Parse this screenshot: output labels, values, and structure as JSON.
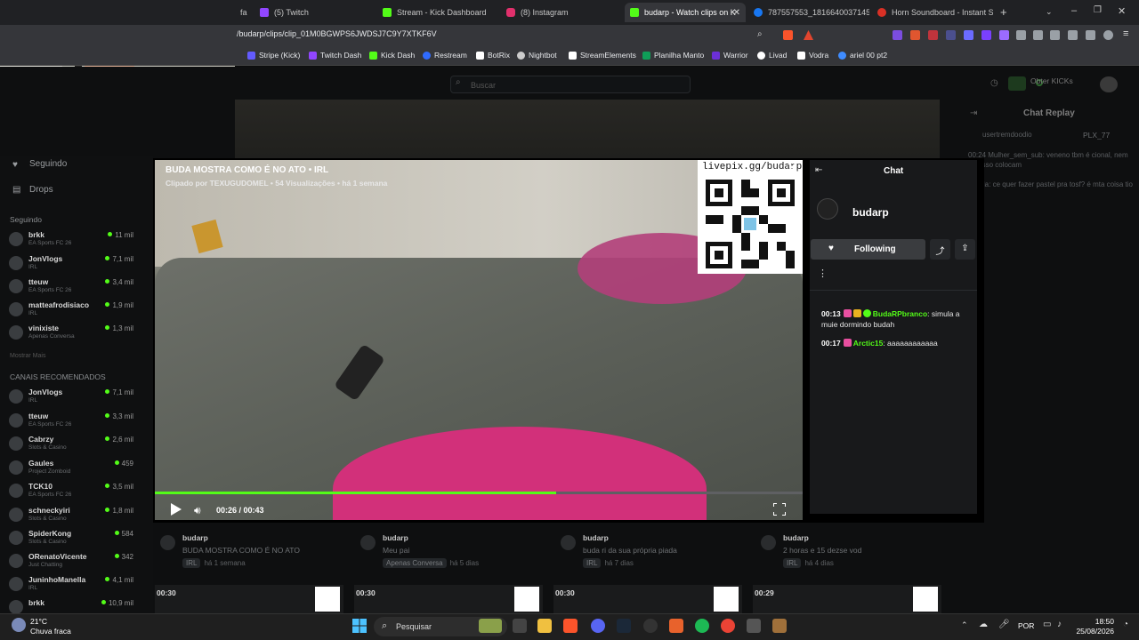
{
  "browser": {
    "tabs": [
      {
        "label": "fa",
        "color": "#9146ff"
      },
      {
        "label": "(5) Twitch",
        "color": "#9146ff"
      },
      {
        "label": "Stream - Kick Dashboard",
        "color": "#53fc18"
      },
      {
        "label": "(8) Instagram",
        "color": "#e1306c"
      },
      {
        "label": "budarp - Watch clips on K",
        "color": "#53fc18"
      },
      {
        "label": "787557553_181664003714507",
        "color": "#1877f2"
      },
      {
        "label": "Horn Soundboard - Instant So",
        "color": "#d93025"
      }
    ],
    "new_tab": "+",
    "url": "/budarp/clips/clip_01M0BGWPS6JWDSJ7C9Y7XTKF6V",
    "bookmarks": [
      {
        "label": "Stripe (Kick)",
        "color": "#635bff"
      },
      {
        "label": "Twitch Dash",
        "color": "#9146ff"
      },
      {
        "label": "Kick Dash",
        "color": "#53fc18"
      },
      {
        "label": "Restream",
        "color": "#2f6bff"
      },
      {
        "label": "BotRix",
        "color": "#ffffff"
      },
      {
        "label": "Nightbot",
        "color": "#cccccc"
      },
      {
        "label": "StreamElements",
        "color": "#ffffff"
      },
      {
        "label": "Planilha Manto",
        "color": "#0f9d58"
      },
      {
        "label": "Warrior",
        "color": "#6b2fd6"
      },
      {
        "label": "Livad",
        "color": "#ffffff"
      },
      {
        "label": "Vodra",
        "color": "#ffffff"
      },
      {
        "label": "ariel 00 pt2",
        "color": "#3f8cff"
      }
    ]
  },
  "kick": {
    "search_placeholder": "Buscar",
    "get_kicks": "Obter KICKs",
    "chat_replay_title": "Chat Replay",
    "replay_users": [
      "usertremdoodio",
      "PLX_77"
    ],
    "replay_lines": [
      "00:24 Mulher_sem_sub: veneno tbm é cional, nem por isso colocam",
      "lilorela: ce quer fazer pastel pra tosf? é mta coisa tio"
    ],
    "sidebar": {
      "nav": [
        {
          "label": "Seguindo"
        },
        {
          "label": "Drops"
        }
      ],
      "following_header": "Seguindo",
      "following": [
        {
          "name": "brkk",
          "game": "EA Sports FC 26",
          "viewers": "11 mil"
        },
        {
          "name": "JonVlogs",
          "game": "IRL",
          "viewers": "7,1 mil"
        },
        {
          "name": "tteuw",
          "game": "EA Sports FC 26",
          "viewers": "3,4 mil"
        },
        {
          "name": "matteafrodisiaco",
          "game": "IRL",
          "viewers": "1,9 mil"
        },
        {
          "name": "vinixiste",
          "game": "Apenas Conversa",
          "viewers": "1,3 mil"
        }
      ],
      "show_more": "Mostrar Mais",
      "recommended_header": "CANAIS RECOMENDADOS",
      "recommended": [
        {
          "name": "JonVlogs",
          "game": "IRL",
          "viewers": "7,1 mil"
        },
        {
          "name": "tteuw",
          "game": "EA Sports FC 26",
          "viewers": "3,3 mil"
        },
        {
          "name": "Cabrzy",
          "game": "Slots & Casino",
          "viewers": "2,6 mil"
        },
        {
          "name": "Gaules",
          "game": "Project Zomboid",
          "viewers": "459"
        },
        {
          "name": "TCK10",
          "game": "EA Sports FC 26",
          "viewers": "3,5 mil"
        },
        {
          "name": "schneckyiri",
          "game": "Slots & Casino",
          "viewers": "1,8 mil"
        },
        {
          "name": "SpiderKong",
          "game": "Slots & Casino",
          "viewers": "584"
        },
        {
          "name": "ORenatoVicente",
          "game": "Just Chatting",
          "viewers": "342"
        },
        {
          "name": "JuninhoManella",
          "game": "IRL",
          "viewers": "4,1 mil"
        },
        {
          "name": "brkk",
          "game": "",
          "viewers": "10,9 mil"
        }
      ]
    },
    "clip_modal": {
      "title": "BUDA MOSTRA COMO É NO ATO • IRL",
      "subtitle": "Clipado por TEXUGUDOMEL • 54 Visualizações • há 1 semana",
      "qr_label": "livepix.gg/budarp",
      "time": "00:26 / 00:43",
      "progress": 0.62
    },
    "chat": {
      "title": "Chat",
      "channel": "budarp",
      "follow_label": "Following",
      "messages": [
        {
          "time": "00:13",
          "user": "BudaRPbranco",
          "text": ": simula a muie dormindo budah"
        },
        {
          "time": "00:17",
          "user": "Arctic15",
          "text": ": aaaaaaaaaaaa"
        }
      ]
    },
    "clips": [
      {
        "user": "budarp",
        "title": "BUDA MOSTRA COMO É NO ATO",
        "tag": "IRL",
        "ago": "há 1 semana",
        "duration": "00:30"
      },
      {
        "user": "budarp",
        "title": "Meu pai",
        "tag": "Apenas Conversa",
        "ago": "há 5 dias",
        "duration": "00:30"
      },
      {
        "user": "budarp",
        "title": "buda ri da sua própria piada",
        "tag": "IRL",
        "ago": "há 7 dias",
        "duration": "00:30"
      },
      {
        "user": "budarp",
        "title": "2 horas e 15 dezse vod",
        "tag": "IRL",
        "ago": "há 4 dias",
        "duration": "00:29"
      }
    ]
  },
  "taskbar": {
    "weather_temp": "21°C",
    "weather_desc": "Chuva fraca",
    "search_placeholder": "Pesquisar",
    "language": "POR",
    "time": "18:50",
    "date": "25/08/2026"
  }
}
